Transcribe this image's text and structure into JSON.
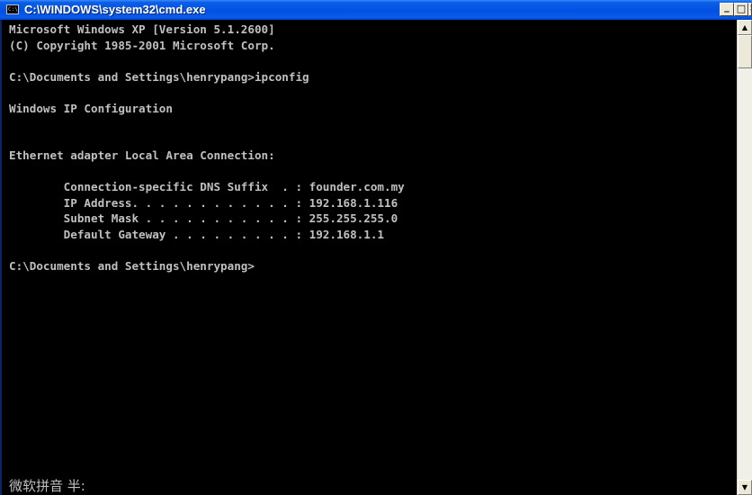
{
  "window": {
    "title": "C:\\WINDOWS\\system32\\cmd.exe",
    "icon_text": "C:\\",
    "icon": "cmd-console-icon",
    "controls": {
      "minimize": "_",
      "maximize": "□",
      "close": "×"
    }
  },
  "console": {
    "text": "Microsoft Windows XP [Version 5.1.2600]\n(C) Copyright 1985-2001 Microsoft Corp.\n\nC:\\Documents and Settings\\henrypang>ipconfig\n\nWindows IP Configuration\n\n\nEthernet adapter Local Area Connection:\n\n        Connection-specific DNS Suffix  . : founder.com.my\n        IP Address. . . . . . . . . . . . : 192.168.1.116\n        Subnet Mask . . . . . . . . . . . : 255.255.255.0\n        Default Gateway . . . . . . . . . : 192.168.1.1\n\nC:\\Documents and Settings\\henrypang>",
    "ime_status": "微软拼音 半:"
  },
  "scrollbar": {
    "up_arrow": "▲",
    "down_arrow": "▼"
  },
  "colors": {
    "titlebar": "#0454e6",
    "console_background": "#000000",
    "console_text": "#c0c0c0",
    "button_face": "#ece9d8"
  }
}
